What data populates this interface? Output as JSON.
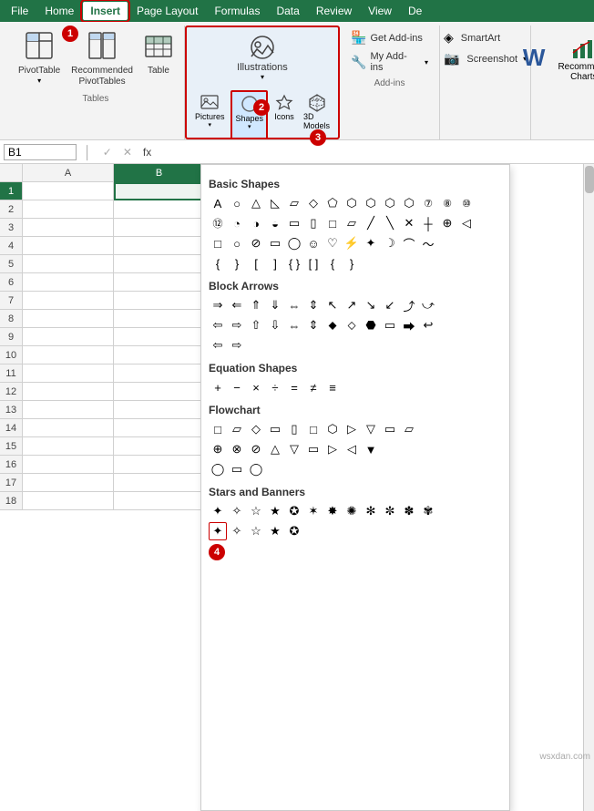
{
  "menubar": {
    "items": [
      "File",
      "Home",
      "Insert",
      "Page Layout",
      "Formulas",
      "Data",
      "Review",
      "View",
      "De"
    ]
  },
  "ribbon": {
    "groups": [
      {
        "name": "Tables",
        "label": "Tables",
        "buttons": [
          {
            "id": "pivot-table",
            "label": "PivotTable",
            "icon": "⊞",
            "hasDropdown": true
          },
          {
            "id": "recommended-pivot",
            "label": "Recommended\nPivotTables",
            "icon": "📊",
            "hasDropdown": false
          },
          {
            "id": "table",
            "label": "Table",
            "icon": "⊞",
            "hasDropdown": false
          }
        ]
      },
      {
        "name": "Illustrations",
        "label": "Illustrations",
        "buttons": [
          {
            "id": "pictures",
            "label": "Pictures",
            "icon": "🖼"
          },
          {
            "id": "shapes",
            "label": "Shapes",
            "icon": "⬡",
            "highlighted": true
          },
          {
            "id": "icons",
            "label": "Icons",
            "icon": "⭐"
          },
          {
            "id": "3d-models",
            "label": "3D\nModels",
            "icon": "🎲"
          }
        ]
      },
      {
        "name": "AddIns",
        "label": "Add-ins",
        "buttons": [
          {
            "id": "get-addins",
            "label": "Get Add-ins",
            "icon": "🏪"
          },
          {
            "id": "my-addins",
            "label": "My Add-ins",
            "icon": "🔧"
          }
        ]
      },
      {
        "name": "Text",
        "label": "",
        "buttons": [
          {
            "id": "smartart",
            "label": "SmartArt",
            "icon": "◈"
          },
          {
            "id": "screenshot",
            "label": "Screenshot",
            "icon": "📷"
          }
        ]
      },
      {
        "name": "Charts",
        "label": "",
        "buttons": [
          {
            "id": "word",
            "label": "W",
            "icon": "W"
          },
          {
            "id": "recommend-charts",
            "label": "Recommend\nCharts",
            "icon": "📈"
          }
        ]
      }
    ]
  },
  "formulabar": {
    "namebox": "B1",
    "formula": "fx"
  },
  "columns": [
    "A",
    "B"
  ],
  "rows": [
    "1",
    "2",
    "3",
    "4",
    "5",
    "6",
    "7",
    "8",
    "9",
    "10",
    "11",
    "12",
    "13",
    "14",
    "15",
    "16",
    "17",
    "18"
  ],
  "shapespanel": {
    "categories": [
      {
        "title": "Basic Shapes",
        "rows": [
          [
            "A",
            "○",
            "△",
            "▷",
            "◁",
            "⬡",
            "⬠",
            "⬣",
            "⑦",
            "⑧",
            "⑩"
          ],
          [
            "⑫",
            "◔",
            "◑",
            "▭",
            "▯",
            "□",
            "▱",
            "╱",
            "╲",
            "✕",
            "┼",
            "⊕",
            "◁"
          ],
          [
            "□",
            "○",
            "⊘",
            "▭",
            "◯",
            "☺",
            "♡",
            "✦",
            "☽",
            "⌒"
          ],
          [
            "{ }",
            " { ",
            " } ",
            "[ ",
            "[ ]",
            " ]",
            "{ ",
            " }"
          ]
        ]
      },
      {
        "title": "Block Arrows",
        "rows": [
          [
            "⇒",
            "⇐",
            "⇑",
            "⇔",
            "⇕",
            "↑",
            "↕",
            "⤻",
            "↪",
            "↩",
            "⤹",
            "⤻"
          ],
          [
            "⇦",
            "⇧",
            "⇨",
            "⇩",
            "⇔",
            "⇕",
            "⇒",
            "⇒",
            "⬥",
            "⬦",
            "⬣",
            "▭"
          ],
          [
            "⇦",
            "⇨"
          ]
        ]
      },
      {
        "title": "Equation Shapes",
        "rows": [
          [
            "+",
            "−",
            "×",
            "÷",
            "=",
            "≠",
            "≡"
          ]
        ]
      },
      {
        "title": "Flowchart",
        "rows": [
          [
            "□",
            "▱",
            "◇",
            "□",
            "▭",
            "▯",
            "⬡",
            "▷",
            "▽",
            "▭",
            "▱"
          ],
          [
            "⊕",
            "⊗",
            "⊘",
            "△",
            "▽",
            "▭",
            "▷",
            "◁",
            "▼"
          ],
          [
            "◯",
            "▭",
            "◯"
          ]
        ]
      },
      {
        "title": "Stars and Banners",
        "rows": [
          [
            "✦",
            "✧",
            "☆",
            "★",
            "✪",
            "🌟",
            "✨",
            "✦",
            "✦",
            "✦",
            "✦",
            "✦"
          ],
          [
            "✦",
            "✦",
            "✦",
            "✦",
            "✦"
          ]
        ]
      }
    ]
  },
  "steps": {
    "step1": "1",
    "step2": "2",
    "step3": "3",
    "step4": "4"
  },
  "watermark": "wsxdan.com"
}
